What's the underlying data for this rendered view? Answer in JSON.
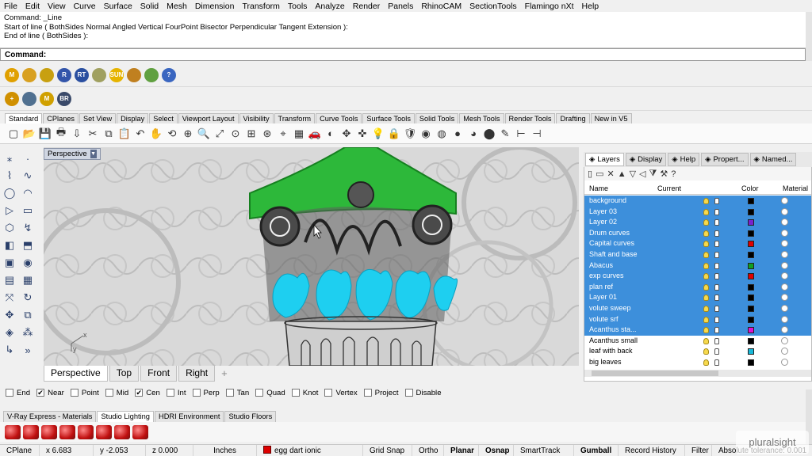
{
  "menu": [
    "File",
    "Edit",
    "View",
    "Curve",
    "Surface",
    "Solid",
    "Mesh",
    "Dimension",
    "Transform",
    "Tools",
    "Analyze",
    "Render",
    "Panels",
    "RhinoCAM",
    "SectionTools",
    "Flamingo nXt",
    "Help"
  ],
  "command": {
    "history": [
      "Command: _Line",
      "Start of line ( BothSides  Normal  Angled  Vertical  FourPoint  Bisector  Perpendicular  Tangent  Extension ):",
      "End of line ( BothSides ):"
    ],
    "prompt_label": "Command:",
    "value": ""
  },
  "plugin_row1": [
    {
      "icon": "m-icon",
      "text": "M",
      "color": "#e0a000"
    },
    {
      "icon": "tag-icon",
      "text": "",
      "color": "#d8a020"
    },
    {
      "icon": "tag2-icon",
      "text": "",
      "color": "#c8a010"
    },
    {
      "icon": "r-icon",
      "text": "R",
      "color": "#3355aa"
    },
    {
      "icon": "rt-icon",
      "text": "RT",
      "color": "#2a4fa0"
    },
    {
      "icon": "light-icon",
      "text": "",
      "color": "#a0a060"
    },
    {
      "icon": "sun-icon",
      "text": "SUN",
      "color": "#e6b400"
    },
    {
      "icon": "lamp-icon",
      "text": "",
      "color": "#c08020"
    },
    {
      "icon": "landscape-icon",
      "text": "",
      "color": "#60a040"
    },
    {
      "icon": "help-icon",
      "text": "?",
      "color": "#3a66c0"
    }
  ],
  "plugin_row2": [
    {
      "icon": "crosshair-icon",
      "text": "+",
      "color": "#d09000"
    },
    {
      "icon": "bottle-icon",
      "text": "",
      "color": "#507090"
    },
    {
      "icon": "mi-icon",
      "text": "M",
      "color": "#d0a000"
    },
    {
      "icon": "br-icon",
      "text": "BR",
      "color": "#3a4a6a"
    }
  ],
  "toolbar_tabs": [
    "Standard",
    "CPlanes",
    "Set View",
    "Display",
    "Select",
    "Viewport Layout",
    "Visibility",
    "Transform",
    "Curve Tools",
    "Surface Tools",
    "Solid Tools",
    "Mesh Tools",
    "Render Tools",
    "Drafting",
    "New in V5"
  ],
  "standard_tools": [
    "new-icon",
    "open-icon",
    "save-icon",
    "print-icon",
    "import-icon",
    "cut-icon",
    "copy-icon",
    "paste-icon",
    "undo-icon",
    "pan-icon",
    "rotate-view-icon",
    "zoom-window-icon",
    "zoom-icon",
    "zoom-extents-icon",
    "zoom-selected-icon",
    "zoom-all-icon",
    "zoom-dynamic-icon",
    "zoom-target-icon",
    "grid-icon",
    "car-icon",
    "shade-icon",
    "gizmo-icon",
    "osnap-icon",
    "light-bulb-icon",
    "lock-icon",
    "shield-icon",
    "color-wheel-icon",
    "material-icon",
    "render-preview-icon",
    "render-icon",
    "sphere-icon",
    "pencil-icon",
    "dimension-icon",
    "ruler-icon"
  ],
  "left_tools": [
    "point-icon",
    "small-point-icon",
    "polyline-icon",
    "curve-icon",
    "circle-icon",
    "arc-icon",
    "triangle-icon",
    "rectangle-icon",
    "polygon-icon",
    "spline-icon",
    "surface-icon",
    "extrude-icon",
    "box-icon",
    "sphere-tool-icon",
    "solid-icon",
    "mesh-icon",
    "transform-icon",
    "rotate-tool-icon",
    "move-icon",
    "group-icon",
    "palette-icon",
    "dots-icon",
    "hook-icon",
    "more-icon"
  ],
  "viewport": {
    "title": "Perspective",
    "axis_x": "x",
    "axis_y": "y",
    "tabs": [
      "Perspective",
      "Top",
      "Front",
      "Right"
    ],
    "active_tab": "Perspective"
  },
  "panel": {
    "tabs": [
      {
        "label": "Layers",
        "icon": "layers-icon"
      },
      {
        "label": "Display",
        "icon": "display-icon"
      },
      {
        "label": "Help",
        "icon": "help-panel-icon"
      },
      {
        "label": "Propert...",
        "icon": "properties-icon"
      },
      {
        "label": "Named...",
        "icon": "named-views-icon"
      }
    ],
    "columns": [
      "Name",
      "Current",
      "Color",
      "Material"
    ],
    "layers": [
      {
        "name": "background",
        "color": "#000000",
        "selected": true
      },
      {
        "name": "Layer 03",
        "color": "#000000",
        "selected": true
      },
      {
        "name": "Layer 02",
        "color": "#7a22cc",
        "selected": true
      },
      {
        "name": "Drum curves",
        "color": "#000000",
        "selected": true
      },
      {
        "name": "Capital curves",
        "color": "#e00000",
        "selected": true
      },
      {
        "name": "Shaft and base",
        "color": "#000000",
        "selected": true
      },
      {
        "name": "Abacus",
        "color": "#10a020",
        "selected": true
      },
      {
        "name": "exp curves",
        "color": "#e00000",
        "selected": true
      },
      {
        "name": "plan ref",
        "color": "#000000",
        "selected": true
      },
      {
        "name": "Layer 01",
        "color": "#000000",
        "selected": true
      },
      {
        "name": "volute sweep",
        "color": "#000000",
        "selected": true
      },
      {
        "name": "volute srf",
        "color": "#000000",
        "selected": true
      },
      {
        "name": "Acanthus sta...",
        "color": "#e010d0",
        "selected": true
      },
      {
        "name": "Acanthus small",
        "color": "#000000",
        "selected": false
      },
      {
        "name": "leaf with back",
        "color": "#18b8d8",
        "selected": false
      },
      {
        "name": "big leaves",
        "color": "#000000",
        "selected": false
      }
    ]
  },
  "osnaps": [
    {
      "label": "End",
      "checked": false
    },
    {
      "label": "Near",
      "checked": true
    },
    {
      "label": "Point",
      "checked": false
    },
    {
      "label": "Mid",
      "checked": false
    },
    {
      "label": "Cen",
      "checked": true
    },
    {
      "label": "Int",
      "checked": false
    },
    {
      "label": "Perp",
      "checked": false
    },
    {
      "label": "Tan",
      "checked": false
    },
    {
      "label": "Quad",
      "checked": false
    },
    {
      "label": "Knot",
      "checked": false
    },
    {
      "label": "Vertex",
      "checked": false
    },
    {
      "label": "Project",
      "checked": false
    },
    {
      "label": "Disable",
      "checked": false
    }
  ],
  "bottom_tabs": [
    "V-Ray Express - Materials",
    "Studio Lighting",
    "HDRI Environment",
    "Studio Floors"
  ],
  "bottom_active": "Studio Lighting",
  "material_count": 8,
  "status": {
    "cplane": "CPlane",
    "x": "x 6.683",
    "y": "y -2.053",
    "z": "z 0.000",
    "units": "Inches",
    "layer": "egg dart ionic",
    "grid_snap": "Grid Snap",
    "ortho": "Ortho",
    "planar": "Planar",
    "osnap": "Osnap",
    "smarttrack": "SmartTrack",
    "gumball": "Gumball",
    "record_history": "Record History",
    "filter": "Filter",
    "tolerance": "Absolute tolerance: 0.001"
  },
  "watermark": "pluralsight"
}
